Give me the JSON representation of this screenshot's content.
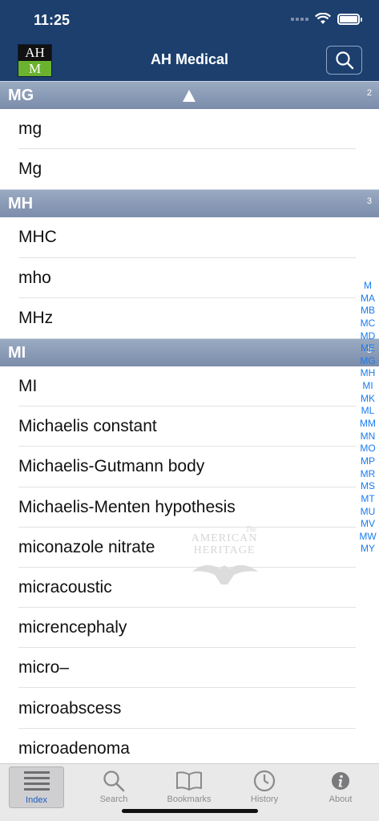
{
  "status": {
    "time": "11:25"
  },
  "header": {
    "logo_top": "AH",
    "logo_bottom": "M",
    "title": "AH Medical",
    "search_icon": "search-icon"
  },
  "sections": [
    {
      "label": "MG",
      "count": "2",
      "items": [
        "mg",
        "Mg"
      ]
    },
    {
      "label": "MH",
      "count": "3",
      "items": [
        "MHC",
        "mho",
        "MHz"
      ]
    },
    {
      "label": "MI",
      "count": "3",
      "items": [
        "MI",
        "Michaelis constant",
        "Michaelis-Gutmann body",
        "Michaelis-Menten hypothesis",
        "miconazole nitrate",
        "micracoustic",
        "micrencephaly",
        "micro–",
        "microabscess",
        "microadenoma"
      ]
    }
  ],
  "watermark": {
    "the": "The",
    "line1": "AMERICAN",
    "line2": "HERITAGE"
  },
  "index_letters": [
    "M",
    "MA",
    "MB",
    "MC",
    "MD",
    "ME",
    "MG",
    "MH",
    "MI",
    "MK",
    "ML",
    "MM",
    "MN",
    "MO",
    "MP",
    "MR",
    "MS",
    "MT",
    "MU",
    "MV",
    "MW",
    "MY"
  ],
  "tabs": [
    {
      "label": "Index",
      "icon": "list-icon",
      "active": true
    },
    {
      "label": "Search",
      "icon": "search-icon"
    },
    {
      "label": "Bookmarks",
      "icon": "book-icon"
    },
    {
      "label": "History",
      "icon": "clock-icon"
    },
    {
      "label": "About",
      "icon": "info-icon"
    }
  ],
  "colors": {
    "header_bg": "#1c3f6e",
    "section_bg": "#8596b2",
    "index_blue": "#1a7cf0",
    "logo_green": "#6bb32e"
  }
}
